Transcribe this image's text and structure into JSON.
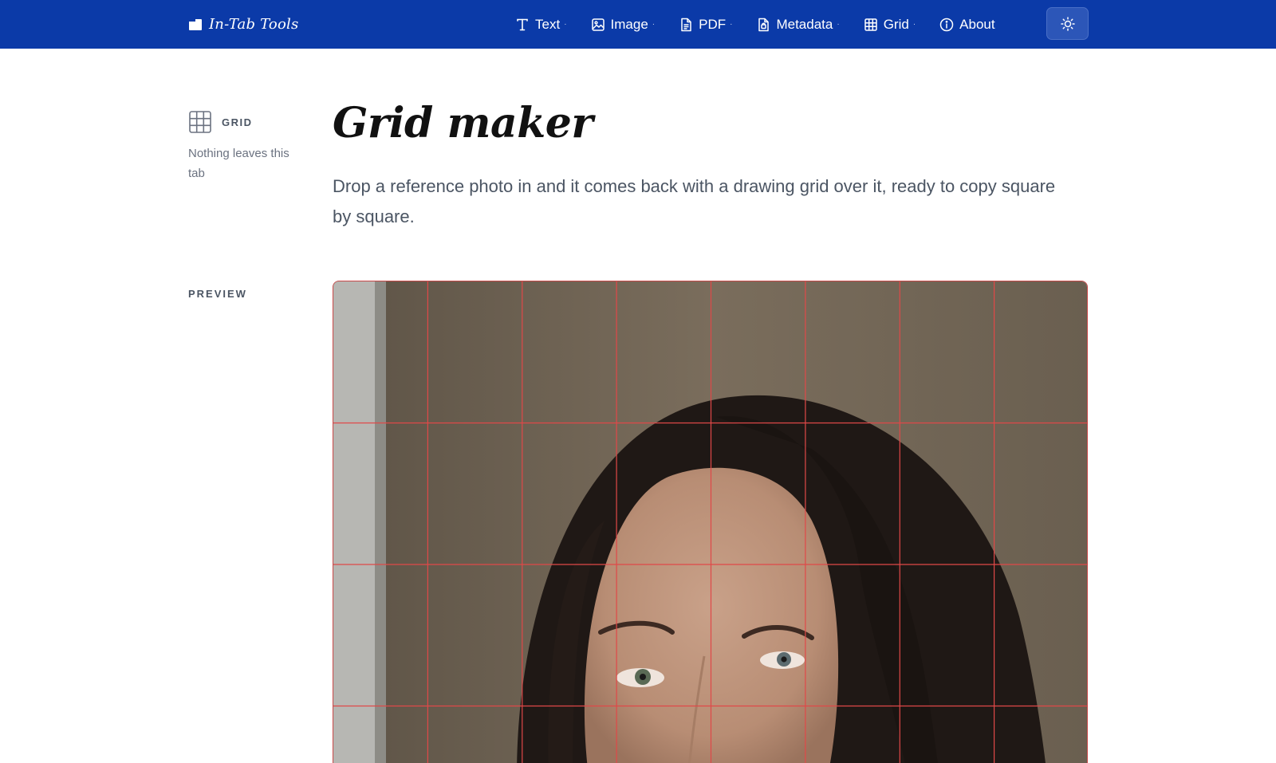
{
  "app": {
    "brand": "In-Tab Tools"
  },
  "nav": {
    "items": [
      {
        "label": "Text",
        "icon": "text-icon",
        "dropdown": true
      },
      {
        "label": "Image",
        "icon": "image-icon",
        "dropdown": true
      },
      {
        "label": "PDF",
        "icon": "pdf-icon",
        "dropdown": true
      },
      {
        "label": "Metadata",
        "icon": "metadata-icon",
        "dropdown": true
      },
      {
        "label": "Grid",
        "icon": "grid-icon",
        "dropdown": true
      },
      {
        "label": "About",
        "icon": "info-icon",
        "dropdown": false
      }
    ],
    "dropdown_marker": "·",
    "theme_toggle_icon": "sun-icon"
  },
  "rail": {
    "label": "GRID",
    "icon": "grid-icon",
    "note": "Nothing leaves this tab"
  },
  "page": {
    "title": "Grid maker",
    "description": "Drop a reference photo in and it comes back with a drawing grid over it, ready to copy square by square."
  },
  "preview": {
    "label": "PREVIEW",
    "grid_columns": 8,
    "grid_line_color": "#e04848"
  },
  "colors": {
    "topbar": "#0b3aa8",
    "theme_button": "#2c56b8",
    "grid_lines": "#e04848",
    "photo_background": "#6f6454"
  }
}
